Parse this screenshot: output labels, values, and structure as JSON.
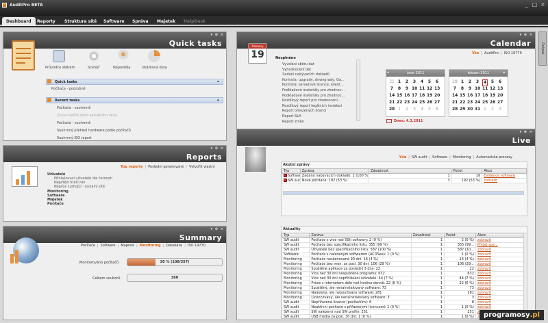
{
  "app": {
    "title": "AuditPro BETA"
  },
  "menu": {
    "tabs": [
      "Dashboard",
      "Reporty",
      "Struktura sítě",
      "Software",
      "Správa",
      "Majetek",
      "HelpDesk"
    ]
  },
  "quick": {
    "title": "Quick tasks",
    "icons": [
      "Průvodce sběrem",
      "Scénář",
      "Nápověda",
      "Ukázková data"
    ],
    "section1": "Quick tasks",
    "section1_items": [
      "Počítače - podrobně"
    ],
    "section2": "Recent tasks",
    "section2_items": [
      "Počítače - souhrnně",
      "Znovu načíst okno aktuálního okna",
      "Počítače - souhrnně",
      "Souhrnný přehled hardware podle počítačů",
      "Souhrnný ISO report"
    ]
  },
  "reports": {
    "title": "Reports",
    "tabs": [
      "Top reporty",
      "Poslední generované",
      "Vytvořit vlastní"
    ],
    "tree": [
      "Uživatelé",
      "Přihlašovací uživatelé dle četnosti",
      "Nejvítězí hráči her",
      "Nejvíce surfující - sociální sítě",
      "Monitoring",
      "Software",
      "Majetek",
      "Počítače"
    ]
  },
  "summary": {
    "title": "Summary",
    "tabs": [
      "Počítače",
      "Software",
      "Majetek",
      "Monitoring",
      "Databáze",
      "ISO 19770"
    ],
    "rows": [
      {
        "label": "Monitorováno počítačů",
        "value": "30 % (108/357)",
        "pct": 0.3
      },
      {
        "label": "Celkem souborů",
        "value": "360",
        "pct": 0
      }
    ]
  },
  "calendar": {
    "title": "Calendar",
    "tabs": [
      "Vše",
      "AuditPro",
      "ISO 19770"
    ],
    "badge_month": "february",
    "badge_day": "19",
    "list_header": "Nesplněno",
    "list": [
      "Vyvolání sběru dat",
      "Vyhodnocení dat",
      "Zadání nabývacích dokladů",
      "Kontrola: upgrady, downgrady, Ga...",
      "Kontrola: serverové licence, klient...",
      "Podkladové materiály pro zhodnoc...",
      "Podkladové materiály pro zhodnoc...",
      "Rozdílový report pro zhodnocení...",
      "Rozdílový report legálních instalací",
      "Report omezených licencí",
      "Report SLA",
      "Report změn"
    ],
    "month1": "únor 2011",
    "month2": "březen 2011",
    "today_label": "Dnes: 4.3.2011",
    "m1_weeks": [
      [
        "31",
        "1",
        "2",
        "3",
        "4",
        "5",
        "6"
      ],
      [
        "7",
        "8",
        "9",
        "10",
        "11",
        "12",
        "13"
      ],
      [
        "14",
        "15",
        "16",
        "17",
        "18",
        "19",
        "20"
      ],
      [
        "21",
        "22",
        "23",
        "24",
        "25",
        "26",
        "27"
      ],
      [
        "28",
        "1",
        "2",
        "3",
        "4",
        "5",
        "6"
      ]
    ],
    "m2_weeks": [
      [
        "28",
        "1",
        "2",
        "3",
        "4",
        "5",
        "6"
      ],
      [
        "7",
        "8",
        "9",
        "10",
        "11",
        "12",
        "13"
      ],
      [
        "14",
        "15",
        "16",
        "17",
        "18",
        "19",
        "20"
      ],
      [
        "21",
        "22",
        "23",
        "24",
        "25",
        "26",
        "27"
      ],
      [
        "28",
        "29",
        "30",
        "31",
        "1",
        "2",
        "3"
      ]
    ]
  },
  "live": {
    "title": "Live",
    "tabs": [
      "Vše",
      "SW audit",
      "Software",
      "Monitoring",
      "Automatické procesy"
    ],
    "t1_title": "Akutní zprávy",
    "t1_cols": [
      "Typ",
      "Zpráva",
      "Závažnost",
      "Počet",
      "Akce"
    ],
    "t1_rows": [
      [
        "Software",
        "Zadáno nabývacích dokladů: 1 (100 %)",
        "1",
        "16",
        "Evidence software"
      ],
      [
        "SW audit",
        "Nové počítače: 192 (53 %)",
        "3",
        "192 (53 %)",
        "zobrazit"
      ]
    ],
    "t2_title": "Aktuality",
    "t2_cols": [
      "Typ",
      "Zpráva",
      "Závažnost",
      "Počet",
      "Akce"
    ],
    "t2_rows": [
      [
        "SW audit",
        "Počítače s více než 50ti softwary: 2 (0 %)",
        "1",
        "2 (0 %)",
        "zobrazit"
      ],
      [
        "SW audit",
        "Počítače bez specifikačního listu: 355 (99 %)",
        "1",
        "355 (99...",
        "Přidat spe..."
      ],
      [
        "SW audit",
        "Uživatelé bez specifikačního listu: 587 (100 %)",
        "1",
        "587 (10...",
        "zobrazit"
      ],
      [
        "Software",
        "Počítače s nalezeným softwarem (ACDSee): 1 (0 %)",
        "1",
        "1 (0 %)",
        "zobrazit"
      ],
      [
        "Monitoring",
        "Počítače neskenované 90 dní: 16 (4 %)",
        "1",
        "16 (4 %)",
        "zobrazit"
      ],
      [
        "Monitoring",
        "Počítače bez mon. za posl. 30 dní: 106 (29 %)",
        "1",
        "106 (29...",
        "zobrazit"
      ],
      [
        "Monitoring",
        "Spuštěné aplikace za poslední 3 dny: 22",
        "1",
        "22",
        "zobrazit"
      ],
      [
        "Monitoring",
        "Více než 30 dní nespuštěné programy: 632",
        "1",
        "632",
        "zobrazit"
      ],
      [
        "Monitoring",
        "Více než 30 dní nepřihlášení uživatelé: 44 (7 %)",
        "1",
        "44 (7 %)",
        "zobrazit"
      ],
      [
        "Monitoring",
        "Práce s internetem déle než hodinu denně: 22 (6 %)",
        "1",
        "22 (6 %)",
        "zobrazit"
      ],
      [
        "Monitoring",
        "Spuštěný, ale nenainstalovaný software: 73",
        "1",
        "73",
        "zobrazit"
      ],
      [
        "Monitoring",
        "Nalezený, ale nepoužívaný software: 281",
        "1",
        "281",
        "zobrazit"
      ],
      [
        "Monitoring",
        "Licencovaný, ale nenainstalovaný software: 3",
        "1",
        "3",
        "zobrazit"
      ],
      [
        "SW audit",
        "Nepřiřazené licence (počítačům): 8",
        "1",
        "8",
        "zobrazit"
      ],
      [
        "SW audit",
        "Neaktivní počítače s přiřazenými licencemi: 1 (0 %)",
        "1",
        "1 (0 %)",
        "zobrazit"
      ],
      [
        "SW audit",
        "SW nalezený nad SW profily: 251",
        "1",
        "251",
        "zobrazit"
      ],
      [
        "SW audit",
        "USB média za posl. 30 dní: 1 (0 %)",
        "1",
        "1 (0 %)",
        "zobrazit"
      ],
      [
        "SW audit",
        "Neaktivní uživatelé s přiřazenými licencemi: 1 (0 %)",
        "1",
        "1 (0 %)",
        "zobrazit"
      ],
      [
        "SW audit",
        "Noví uživatelé: 436 (74 %)",
        "1",
        "436 (74...",
        "zobrazit"
      ],
      [
        "SW audit",
        "Nový hardware: 10",
        "1",
        "10",
        "zobrazit"
      ]
    ]
  },
  "side": {
    "output": "Output"
  },
  "watermark": {
    "a": "programosy",
    "b": ".pl"
  },
  "colors": {
    "accent": "#e05a00",
    "header_dark": "#3c3c3c",
    "bar": "#c4683a"
  }
}
